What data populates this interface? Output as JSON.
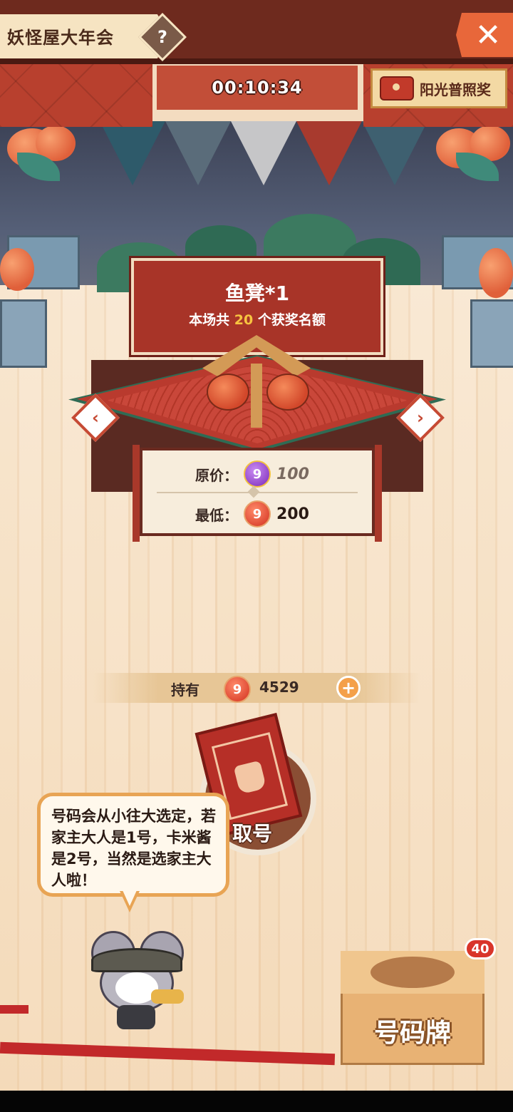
{
  "header": {
    "title": "妖怪屋大年会",
    "help_icon": "?",
    "close_icon": "✕",
    "timer": "00:10:34",
    "sunshine_award_label": "阳光普照奖"
  },
  "prize": {
    "name": "鱼凳*1",
    "quota_prefix": "本场共",
    "quota_count": "20",
    "quota_suffix": "个获奖名额",
    "prev_arrow": "‹",
    "next_arrow": "›"
  },
  "price": {
    "original_label": "原价：",
    "original_value": "100",
    "lowest_label": "最低：",
    "lowest_value": "200",
    "purple_coin_glyph": "9",
    "red_coin_glyph": "9"
  },
  "holdings": {
    "label": "持有",
    "value": "4529",
    "plus": "+"
  },
  "take_number": {
    "label": "取号"
  },
  "speech": {
    "text": "号码会从小往大选定，若家主大人是1号，卡米酱是2号，当然是选家主大人啦！"
  },
  "number_box": {
    "label": "号码牌",
    "badge": "40"
  },
  "colors": {
    "accent_red": "#b8402e",
    "gold": "#f7c440",
    "close_orange": "#e8673a"
  }
}
